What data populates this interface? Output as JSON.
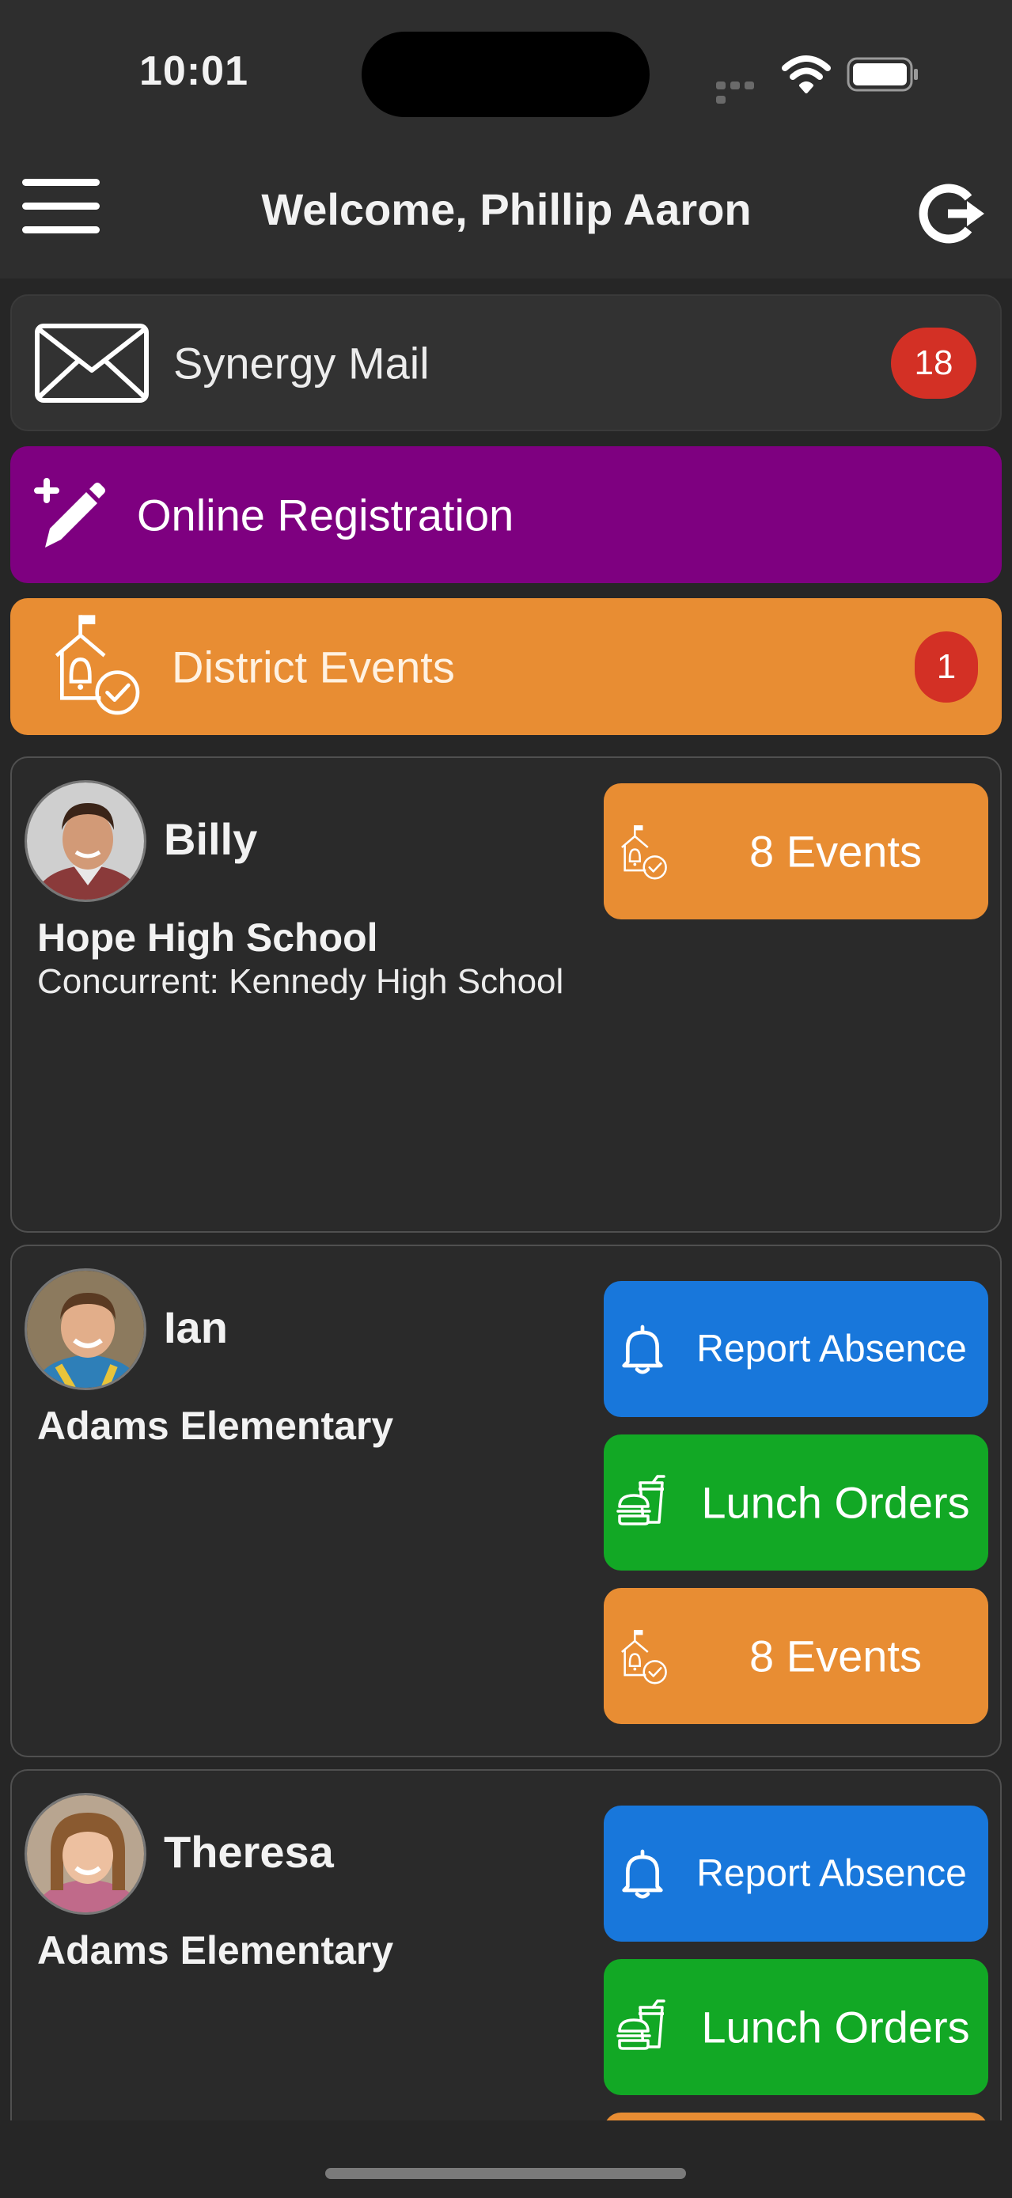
{
  "status_bar": {
    "time": "10:01"
  },
  "header": {
    "title": "Welcome, Phillip Aaron"
  },
  "quick_links": {
    "mail": {
      "label": "Synergy Mail",
      "badge": "18"
    },
    "registration": {
      "label": "Online Registration"
    },
    "district_events": {
      "label": "District Events",
      "badge": "1"
    }
  },
  "students": [
    {
      "name": "Billy",
      "school": "Hope High School",
      "concurrent": "Concurrent: Kennedy High School",
      "events_label": "8 Events"
    },
    {
      "name": "Ian",
      "school": "Adams Elementary",
      "report_absence_label": "Report Absence",
      "lunch_label": "Lunch Orders",
      "events_label": "8 Events"
    },
    {
      "name": "Theresa",
      "school": "Adams Elementary",
      "report_absence_label": "Report Absence",
      "lunch_label": "Lunch Orders"
    }
  ],
  "colors": {
    "registration": "#7e0080",
    "events": "#e88d33",
    "report_absence": "#1877db",
    "lunch": "#12a825",
    "badge": "#d33025"
  },
  "icons": [
    "menu-icon",
    "refresh-icon",
    "mail-icon",
    "pencil-plus-icon",
    "school-bell-check-icon",
    "bell-icon",
    "lunch-icon"
  ]
}
